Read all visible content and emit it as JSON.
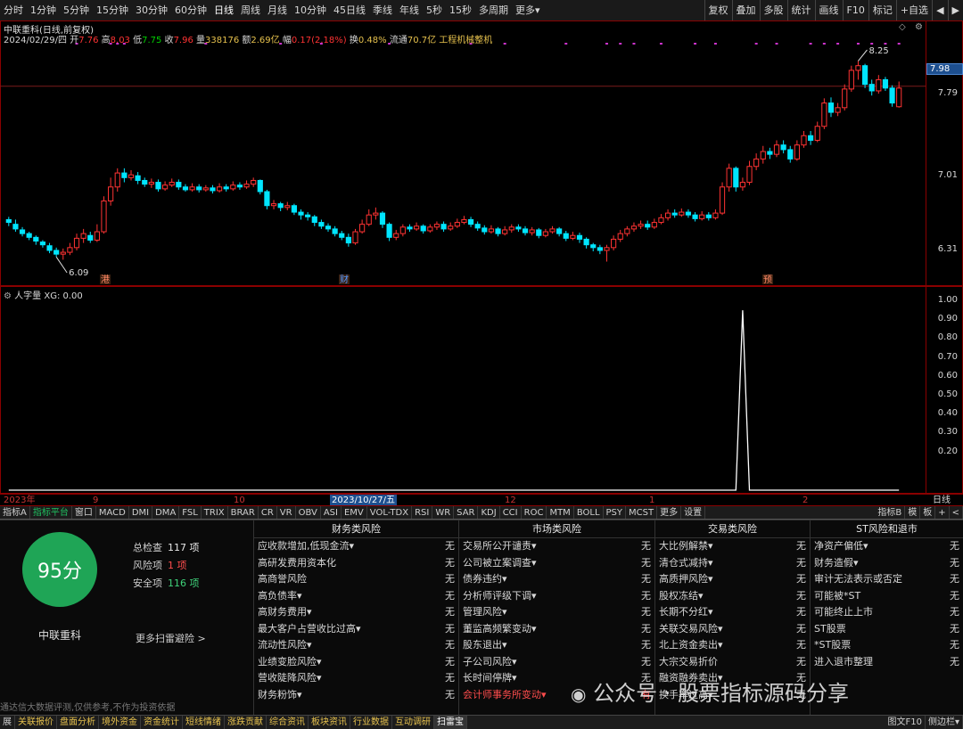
{
  "toolbar": {
    "periods": [
      "分时",
      "1分钟",
      "5分钟",
      "15分钟",
      "30分钟",
      "60分钟",
      "日线",
      "周线",
      "月线",
      "10分钟",
      "45日线",
      "季线",
      "年线",
      "5秒",
      "15秒",
      "多周期",
      "更多▾"
    ],
    "active_period": "日线",
    "right": [
      "复权",
      "叠加",
      "多股",
      "统计",
      "画线",
      "F10",
      "标记",
      "+自选",
      "◀",
      "▶"
    ]
  },
  "chart_header": {
    "title": "中联重科(日线,前复权)",
    "date": "2024/02/29/四",
    "open_label": "开",
    "open": "7.76",
    "high_label": "高",
    "high": "8.03",
    "low_label": "低",
    "low": "7.75",
    "close_label": "收",
    "close": "7.96",
    "volume_label": "量",
    "volume": "338176",
    "amount_label": "额",
    "amount": "2.69亿",
    "change_label": "幅",
    "change": "0.17(2.18%)",
    "turnover_label": "换",
    "turnover": "0.48%",
    "float_label": "流通",
    "float": "70.7亿",
    "sector": "工程机械整机"
  },
  "price_axis": {
    "labels": [
      "7.98",
      "7.79",
      "7.01",
      "6.31"
    ],
    "current": "7.98",
    "high_mark": "8.25",
    "low_mark": "6.09"
  },
  "event_markers": [
    "港",
    "财",
    "预"
  ],
  "indicator": {
    "title": "人字量",
    "value": "XG: 0.00",
    "axis": [
      "1.00",
      "0.90",
      "0.80",
      "0.70",
      "0.60",
      "0.50",
      "0.40",
      "0.30",
      "0.20"
    ]
  },
  "date_axis": {
    "labels": [
      "2023年",
      "9",
      "10",
      "2023/10/27/五",
      "12",
      "1",
      "2",
      "日线"
    ]
  },
  "indicator_tabs": [
    "指标A",
    "指标平台",
    "窗口",
    "MACD",
    "DMI",
    "DMA",
    "FSL",
    "TRIX",
    "BRAR",
    "CR",
    "VR",
    "OBV",
    "ASI",
    "EMV",
    "VOL-TDX",
    "RSI",
    "WR",
    "SAR",
    "KDJ",
    "CCI",
    "ROC",
    "MTM",
    "BOLL",
    "PSY",
    "MCST",
    "更多",
    "设置"
  ],
  "indicator_tabs_right": [
    "指标B",
    "模",
    "板",
    "+",
    "<"
  ],
  "risk": {
    "score": "95分",
    "stock_name": "中联重科",
    "total_label": "总检查",
    "total": "117 项",
    "risk_label": "风险项",
    "risk_count": "1 项",
    "safe_label": "安全项",
    "safe": "116 项",
    "more": "更多扫雷避险 >",
    "disclaimer": "通达信大数据评测,仅供参考,不作为投资依据",
    "columns": [
      {
        "title": "财务类风险",
        "items": [
          [
            "应收款增加,低现金流▾",
            "无"
          ],
          [
            "高研发费用资本化",
            "无"
          ],
          [
            "高商誉风险",
            "无"
          ],
          [
            "高负债率▾",
            "无"
          ],
          [
            "高财务费用▾",
            "无"
          ],
          [
            "最大客户占营收比过高▾",
            "无"
          ],
          [
            "流动性风险▾",
            "无"
          ],
          [
            "业绩变脸风险▾",
            "无"
          ],
          [
            "营收陡降风险▾",
            "无"
          ],
          [
            "财务粉饰▾",
            "无"
          ]
        ]
      },
      {
        "title": "市场类风险",
        "items": [
          [
            "交易所公开谴责▾",
            "无"
          ],
          [
            "公司被立案调查▾",
            "无"
          ],
          [
            "债券违约▾",
            "无"
          ],
          [
            "分析师评级下调▾",
            "无"
          ],
          [
            "管理风险▾",
            "无"
          ],
          [
            "董监高频繁变动▾",
            "无"
          ],
          [
            "股东退出▾",
            "无"
          ],
          [
            "子公司风险▾",
            "无"
          ],
          [
            "长时间停牌▾",
            "无"
          ],
          [
            "会计师事务所变动▾",
            "有"
          ]
        ]
      },
      {
        "title": "交易类风险",
        "items": [
          [
            "大比例解禁▾",
            "无"
          ],
          [
            "清仓式减持▾",
            "无"
          ],
          [
            "高质押风险▾",
            "无"
          ],
          [
            "股权冻结▾",
            "无"
          ],
          [
            "长期不分红▾",
            "无"
          ],
          [
            "关联交易风险▾",
            "无"
          ],
          [
            "北上资金卖出▾",
            "无"
          ],
          [
            "大宗交易折价",
            "无"
          ],
          [
            "融资融券卖出▾",
            "无"
          ],
          [
            "换手率过高▾",
            "无"
          ]
        ]
      },
      {
        "title": "ST风险和退市",
        "items": [
          [
            "净资产偏低▾",
            "无"
          ],
          [
            "财务造假▾",
            "无"
          ],
          [
            "审计无法表示或否定",
            "无"
          ],
          [
            "可能被*ST",
            "无"
          ],
          [
            "可能终止上市",
            "无"
          ],
          [
            "ST股票",
            "无"
          ],
          [
            "*ST股票",
            "无"
          ],
          [
            "进入退市整理",
            "无"
          ]
        ]
      }
    ]
  },
  "bottom_tabs": [
    "展",
    "关联报价",
    "盘面分析",
    "境外资金",
    "资金统计",
    "短线情绪",
    "涨跌贡献",
    "综合资讯",
    "板块资讯",
    "行业数据",
    "互动调研",
    "扫雷宝"
  ],
  "bottom_active": "扫雷宝",
  "bottom_right": [
    "图文F10",
    "侧边栏▾"
  ],
  "watermark": "公众号 · 股票指标源码分享",
  "colors": {
    "up": "#ff3333",
    "down": "#00e5ff",
    "accent": "#8b0000",
    "green": "#1fa556",
    "marker": "#cc33cc"
  },
  "chart_data": {
    "type": "candlestick",
    "title": "中联重科(日线,前复权)",
    "x_range": [
      "2023-07",
      "2024-02-29"
    ],
    "ylim": [
      6.0,
      8.35
    ],
    "candles": [
      [
        6.55,
        6.52,
        6.58,
        6.48
      ],
      [
        6.5,
        6.45,
        6.55,
        6.42
      ],
      [
        6.44,
        6.4,
        6.47,
        6.37
      ],
      [
        6.4,
        6.36,
        6.42,
        6.33
      ],
      [
        6.36,
        6.32,
        6.38,
        6.28
      ],
      [
        6.31,
        6.28,
        6.33,
        6.25
      ],
      [
        6.27,
        6.22,
        6.3,
        6.19
      ],
      [
        6.22,
        6.18,
        6.25,
        6.15
      ],
      [
        6.18,
        6.2,
        6.24,
        6.12
      ],
      [
        6.2,
        6.25,
        6.3,
        6.17
      ],
      [
        6.25,
        6.35,
        6.4,
        6.22
      ],
      [
        6.35,
        6.4,
        6.45,
        6.3
      ],
      [
        6.38,
        6.33,
        6.42,
        6.3
      ],
      [
        6.33,
        6.42,
        6.5,
        6.31
      ],
      [
        6.42,
        6.75,
        6.8,
        6.4
      ],
      [
        6.75,
        6.9,
        7.0,
        6.7
      ],
      [
        6.9,
        7.05,
        7.1,
        6.85
      ],
      [
        7.05,
        7.0,
        7.1,
        6.95
      ],
      [
        7.0,
        7.03,
        7.08,
        6.97
      ],
      [
        7.02,
        6.97,
        7.06,
        6.93
      ],
      [
        6.97,
        6.93,
        7.0,
        6.9
      ],
      [
        6.93,
        6.95,
        6.99,
        6.89
      ],
      [
        6.95,
        6.88,
        6.98,
        6.85
      ],
      [
        6.88,
        6.92,
        6.96,
        6.86
      ],
      [
        6.92,
        6.95,
        6.99,
        6.9
      ],
      [
        6.95,
        6.9,
        6.98,
        6.87
      ],
      [
        6.9,
        6.87,
        6.93,
        6.85
      ],
      [
        6.87,
        6.9,
        6.94,
        6.85
      ],
      [
        6.9,
        6.87,
        6.93,
        6.84
      ],
      [
        6.87,
        6.89,
        6.92,
        6.85
      ],
      [
        6.89,
        6.86,
        6.92,
        6.83
      ],
      [
        6.86,
        6.9,
        6.94,
        6.84
      ],
      [
        6.9,
        6.88,
        6.93,
        6.85
      ],
      [
        6.88,
        6.92,
        6.96,
        6.86
      ],
      [
        6.92,
        6.9,
        6.95,
        6.87
      ],
      [
        6.9,
        6.93,
        6.97,
        6.88
      ],
      [
        6.93,
        6.97,
        7.0,
        6.9
      ],
      [
        6.97,
        6.85,
        6.98,
        6.82
      ],
      [
        6.85,
        6.7,
        6.87,
        6.66
      ],
      [
        6.7,
        6.72,
        6.76,
        6.66
      ],
      [
        6.72,
        6.68,
        6.74,
        6.64
      ],
      [
        6.68,
        6.7,
        6.74,
        6.65
      ],
      [
        6.7,
        6.63,
        6.72,
        6.6
      ],
      [
        6.63,
        6.6,
        6.66,
        6.55
      ],
      [
        6.6,
        6.58,
        6.63,
        6.54
      ],
      [
        6.58,
        6.52,
        6.6,
        6.48
      ],
      [
        6.52,
        6.48,
        6.55,
        6.45
      ],
      [
        6.48,
        6.45,
        6.51,
        6.42
      ],
      [
        6.45,
        6.4,
        6.48,
        6.37
      ],
      [
        6.4,
        6.36,
        6.43,
        6.33
      ],
      [
        6.36,
        6.3,
        6.4,
        6.26
      ],
      [
        6.3,
        6.42,
        6.45,
        6.28
      ],
      [
        6.42,
        6.5,
        6.55,
        6.4
      ],
      [
        6.5,
        6.6,
        6.66,
        6.48
      ],
      [
        6.6,
        6.62,
        6.68,
        6.55
      ],
      [
        6.62,
        6.5,
        6.64,
        6.46
      ],
      [
        6.5,
        6.36,
        6.52,
        6.32
      ],
      [
        6.36,
        6.4,
        6.44,
        6.33
      ],
      [
        6.4,
        6.47,
        6.5,
        6.37
      ],
      [
        6.47,
        6.45,
        6.5,
        6.42
      ],
      [
        6.45,
        6.48,
        6.52,
        6.43
      ],
      [
        6.48,
        6.43,
        6.5,
        6.4
      ],
      [
        6.43,
        6.47,
        6.5,
        6.41
      ],
      [
        6.47,
        6.5,
        6.53,
        6.44
      ],
      [
        6.5,
        6.45,
        6.53,
        6.42
      ],
      [
        6.45,
        6.48,
        6.52,
        6.43
      ],
      [
        6.48,
        6.52,
        6.56,
        6.46
      ],
      [
        6.52,
        6.55,
        6.59,
        6.5
      ],
      [
        6.55,
        6.5,
        6.58,
        6.47
      ],
      [
        6.5,
        6.46,
        6.53,
        6.43
      ],
      [
        6.46,
        6.42,
        6.49,
        6.39
      ],
      [
        6.42,
        6.45,
        6.49,
        6.4
      ],
      [
        6.45,
        6.4,
        6.47,
        6.37
      ],
      [
        6.4,
        6.44,
        6.48,
        6.38
      ],
      [
        6.44,
        6.47,
        6.5,
        6.41
      ],
      [
        6.47,
        6.45,
        6.5,
        6.42
      ],
      [
        6.45,
        6.41,
        6.48,
        6.38
      ],
      [
        6.41,
        6.44,
        6.47,
        6.38
      ],
      [
        6.44,
        6.38,
        6.46,
        6.35
      ],
      [
        6.38,
        6.42,
        6.45,
        6.36
      ],
      [
        6.42,
        6.45,
        6.48,
        6.4
      ],
      [
        6.45,
        6.4,
        6.47,
        6.37
      ],
      [
        6.4,
        6.35,
        6.43,
        6.32
      ],
      [
        6.35,
        6.38,
        6.42,
        6.33
      ],
      [
        6.38,
        6.34,
        6.41,
        6.3
      ],
      [
        6.34,
        6.28,
        6.36,
        6.24
      ],
      [
        6.28,
        6.25,
        6.3,
        6.21
      ],
      [
        6.25,
        6.22,
        6.28,
        6.18
      ],
      [
        6.22,
        6.25,
        6.28,
        6.1
      ],
      [
        6.25,
        6.34,
        6.38,
        6.22
      ],
      [
        6.34,
        6.4,
        6.44,
        6.31
      ],
      [
        6.4,
        6.45,
        6.48,
        6.37
      ],
      [
        6.45,
        6.48,
        6.52,
        6.42
      ],
      [
        6.48,
        6.5,
        6.54,
        6.45
      ],
      [
        6.5,
        6.47,
        6.54,
        6.44
      ],
      [
        6.47,
        6.52,
        6.56,
        6.45
      ],
      [
        6.52,
        6.57,
        6.61,
        6.5
      ],
      [
        6.57,
        6.62,
        6.66,
        6.54
      ],
      [
        6.62,
        6.6,
        6.66,
        6.57
      ],
      [
        6.6,
        6.63,
        6.67,
        6.58
      ],
      [
        6.63,
        6.6,
        6.66,
        6.57
      ],
      [
        6.6,
        6.56,
        6.63,
        6.53
      ],
      [
        6.56,
        6.6,
        6.64,
        6.54
      ],
      [
        6.6,
        6.57,
        6.63,
        6.54
      ],
      [
        6.57,
        6.62,
        6.66,
        6.55
      ],
      [
        6.62,
        6.9,
        6.95,
        6.6
      ],
      [
        6.9,
        7.1,
        7.15,
        6.85
      ],
      [
        7.1,
        6.9,
        7.12,
        6.85
      ],
      [
        6.9,
        6.95,
        7.0,
        6.86
      ],
      [
        6.95,
        7.12,
        7.18,
        6.92
      ],
      [
        7.12,
        7.2,
        7.26,
        7.08
      ],
      [
        7.2,
        7.28,
        7.34,
        7.15
      ],
      [
        7.28,
        7.25,
        7.32,
        7.2
      ],
      [
        7.25,
        7.35,
        7.4,
        7.22
      ],
      [
        7.35,
        7.3,
        7.4,
        7.26
      ],
      [
        7.3,
        7.2,
        7.34,
        7.16
      ],
      [
        7.2,
        7.35,
        7.4,
        7.18
      ],
      [
        7.35,
        7.45,
        7.5,
        7.32
      ],
      [
        7.45,
        7.4,
        7.5,
        7.35
      ],
      [
        7.4,
        7.55,
        7.6,
        7.38
      ],
      [
        7.55,
        7.8,
        7.85,
        7.52
      ],
      [
        7.8,
        7.7,
        7.86,
        7.65
      ],
      [
        7.7,
        7.75,
        7.8,
        7.66
      ],
      [
        7.75,
        7.95,
        8.0,
        7.72
      ],
      [
        7.95,
        8.15,
        8.2,
        7.92
      ],
      [
        8.15,
        8.2,
        8.25,
        8.05
      ],
      [
        8.2,
        8.0,
        8.22,
        7.96
      ],
      [
        8.0,
        7.93,
        8.05,
        7.88
      ],
      [
        7.93,
        8.05,
        8.1,
        7.9
      ],
      [
        8.05,
        7.96,
        8.08,
        7.93
      ],
      [
        7.96,
        7.8,
        7.99,
        7.76
      ],
      [
        7.76,
        7.96,
        8.03,
        7.75
      ]
    ],
    "indicator_series": {
      "name": "XG",
      "peak_index": 108,
      "peak_value": 1.0,
      "ylim": [
        0,
        1.05
      ]
    }
  }
}
